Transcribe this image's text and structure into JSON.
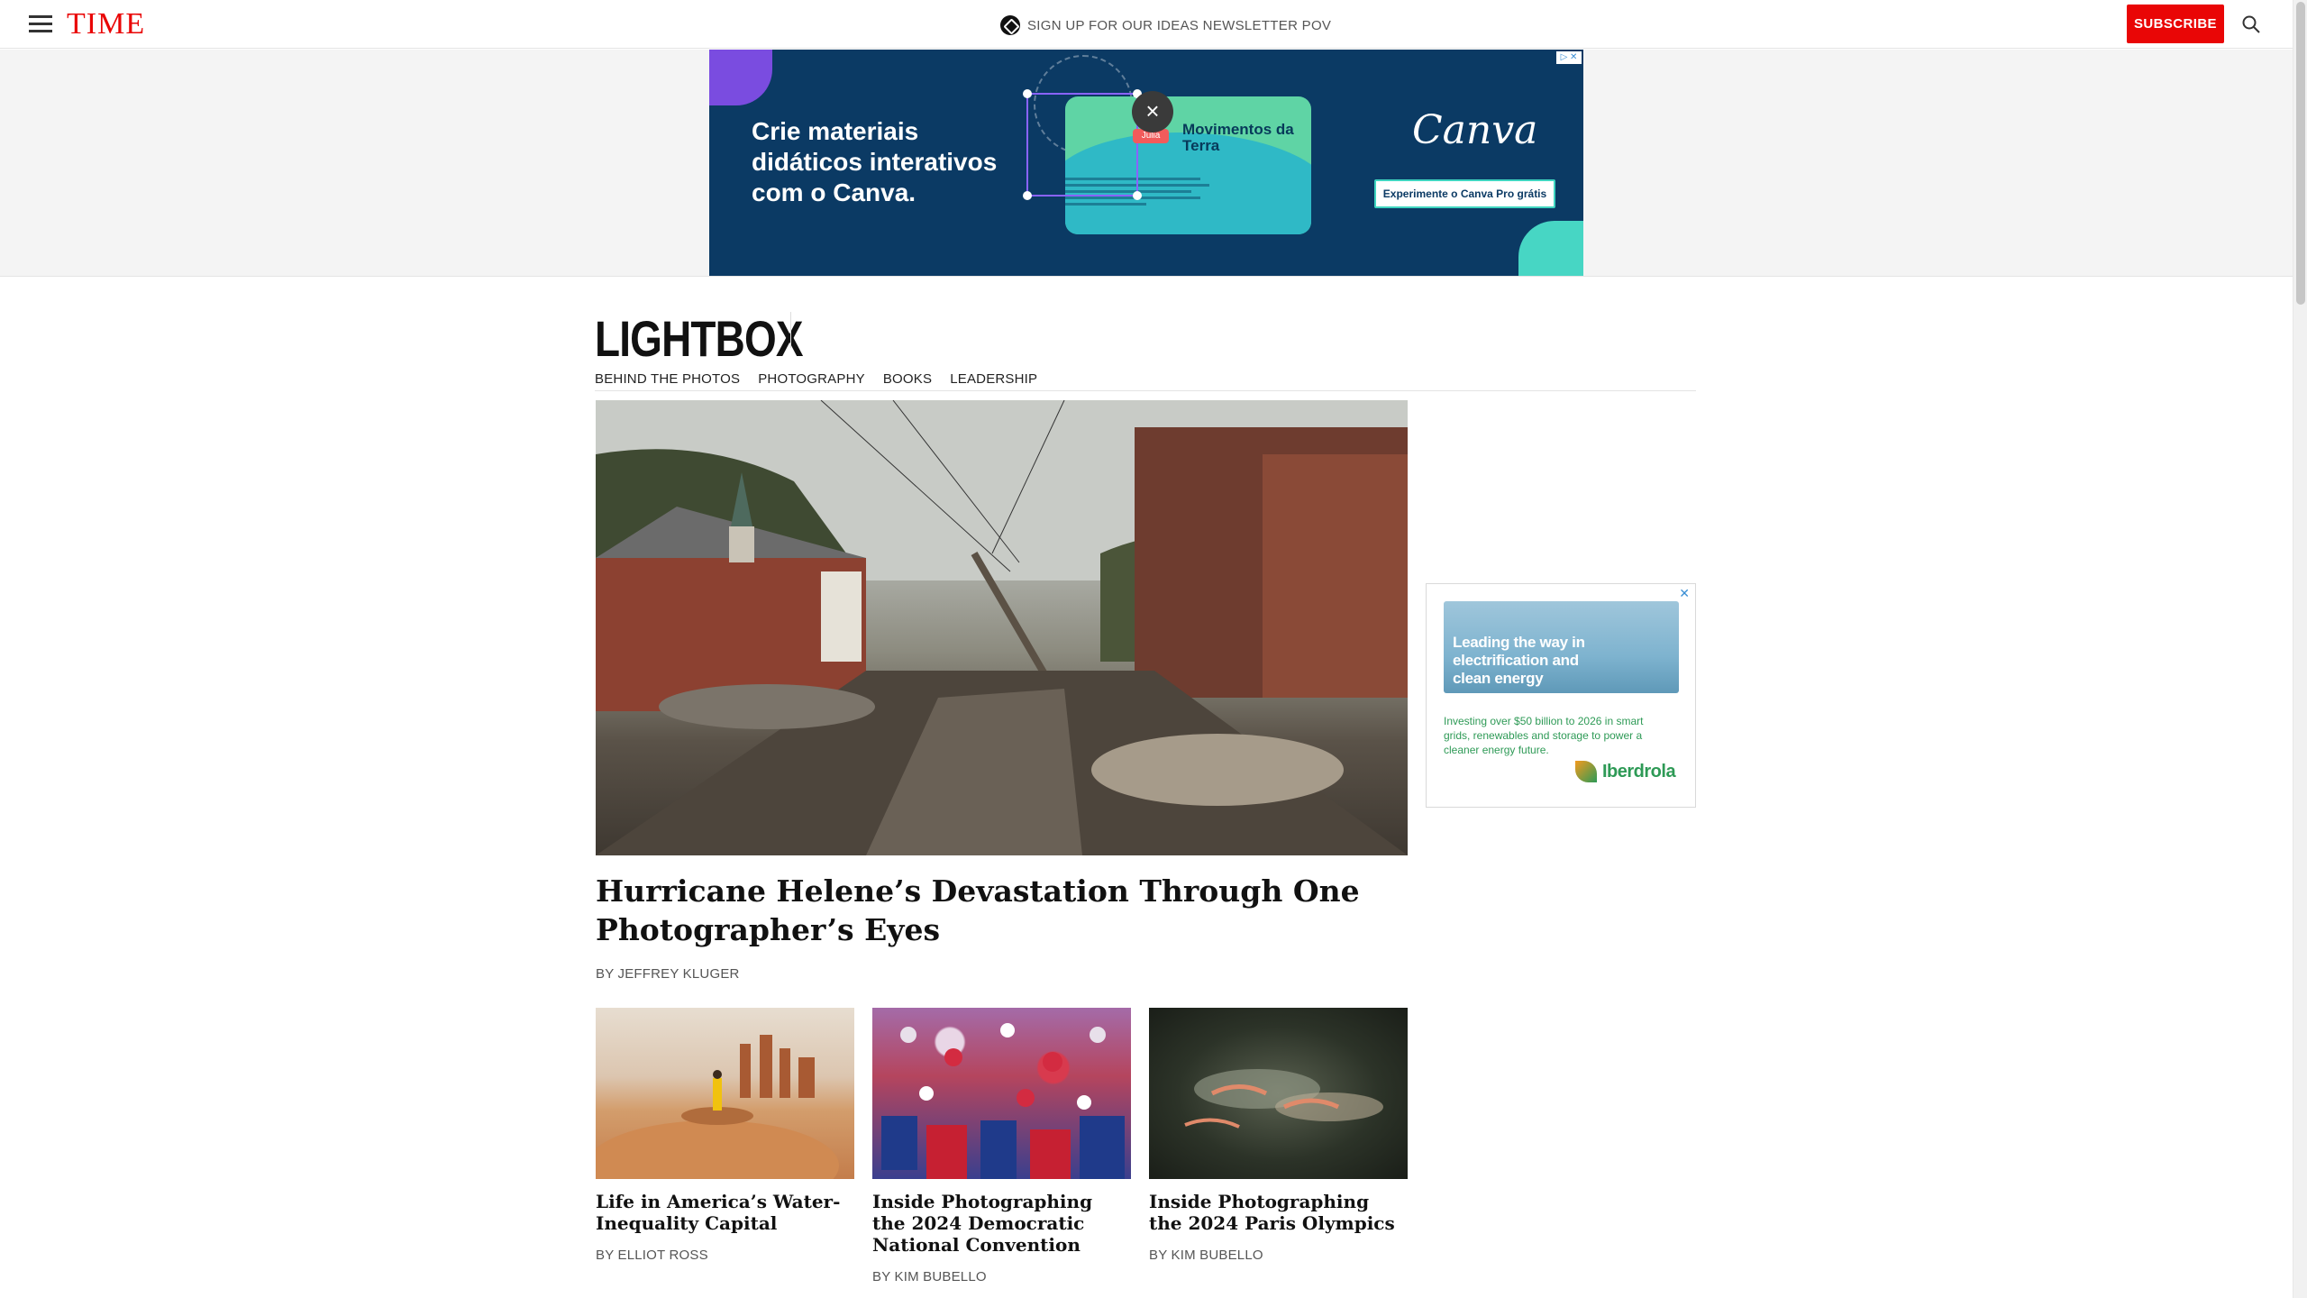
{
  "header": {
    "logo": "TIME",
    "newsletter_text": "SIGN UP FOR OUR IDEAS NEWSLETTER POV",
    "subscribe_label": "SUBSCRIBE"
  },
  "top_ad": {
    "headline": "Crie materiais didáticos interativos com o Canva.",
    "card_title": "Movimentos da Terra",
    "tag": "Julia",
    "brand": "Canva",
    "cta": "Experimente o Canva Pro grátis",
    "close_glyph": "×",
    "adchoices": "▷ ✕"
  },
  "section": {
    "title": "LIGHTBOX",
    "nav": [
      "BEHIND THE PHOTOS",
      "PHOTOGRAPHY",
      "BOOKS",
      "LEADERSHIP"
    ]
  },
  "hero": {
    "title": "Hurricane Helene’s Devastation Through One Photographer’s Eyes",
    "byline": "BY JEFFREY KLUGER"
  },
  "cards": [
    {
      "title": "Life in America’s Water-Inequality Capital",
      "byline": "BY ELLIOT ROSS"
    },
    {
      "title": "Inside Photographing the 2024 Democratic National Convention",
      "byline": "BY KIM BUBELLO"
    },
    {
      "title": "Inside Photographing the 2024 Paris Olympics",
      "byline": "BY KIM BUBELLO"
    }
  ],
  "side_ad": {
    "close_glyph": "✕",
    "headline": "Leading the way in electrification and clean energy",
    "body": "Investing over $50 billion to 2026 in smart grids, renewables and storage to power a cleaner energy future.",
    "brand": "Iberdrola"
  },
  "colors": {
    "brand_red": "#e90606",
    "canva_bg": "#0b3a64",
    "iberdrola_green": "#2e9a56"
  }
}
